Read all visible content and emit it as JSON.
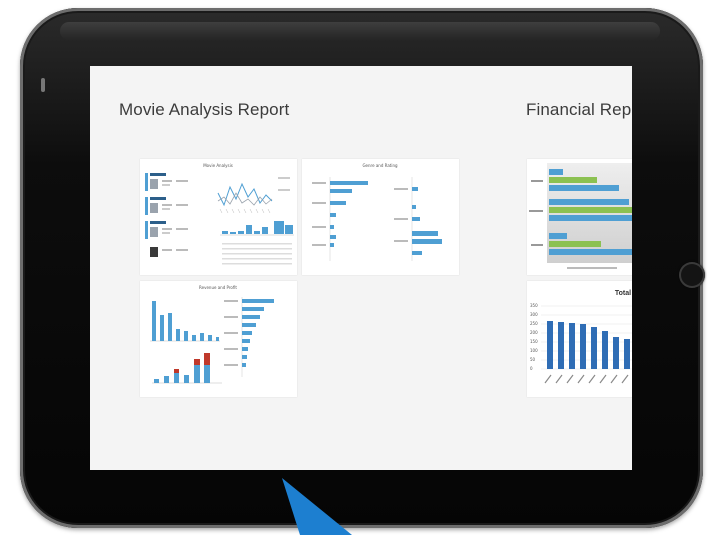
{
  "screen": {
    "reports": [
      {
        "title": "Movie Analysis Report"
      },
      {
        "title": "Financial Rep"
      }
    ],
    "movie_thumbnails": [
      {
        "caption": "Movie Analysis"
      },
      {
        "caption": "Genre and Rating"
      },
      {
        "caption": "Revenue and Profit"
      }
    ],
    "financial_thumbnails": [
      {
        "caption": ""
      },
      {
        "caption": "Total",
        "y_ticks": [
          "350",
          "300",
          "250",
          "200",
          "150",
          "100",
          "50",
          "0"
        ]
      }
    ]
  },
  "colors": {
    "bezel": "#0d0d0d",
    "screen_bg": "#f4f4f4",
    "bar_blue": "#4f9fd3",
    "bar_green": "#8cc152",
    "bar_red": "#c0392b",
    "pointer_blue": "#1d7fd0"
  },
  "icons": [
    "home-button-icon",
    "pointer-arrow-icon"
  ]
}
